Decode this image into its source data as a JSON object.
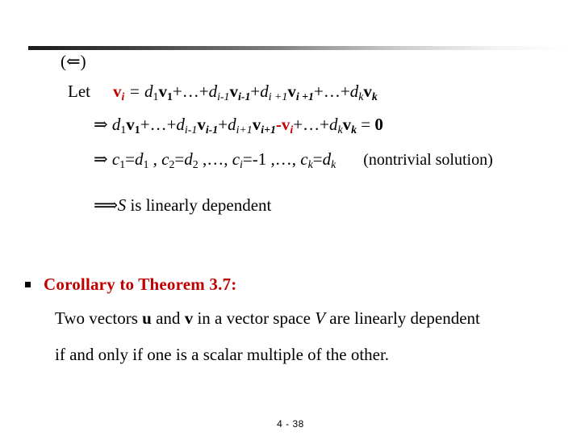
{
  "slide": {
    "direction_marker": "(⇐)",
    "let_label": "Let",
    "equation_1": {
      "lhs_vector": "v",
      "lhs_sub": "i",
      "equals": " = ",
      "terms": "d₁v₁+…+dᵢ₋₁vᵢ₋₁+dᵢ₊₁vᵢ₊₁+…+dₖvₖ",
      "plain": "v_i = d_1 v_1 + … + d_{i-1} v_{i-1} + d_{i+1} v_{i+1} + … + d_k v_k"
    },
    "equation_2": {
      "arrow": "⇒",
      "highlight": "-vᵢ",
      "plain": "⇒ d_1 v_1 + … + d_{i-1} v_{i-1} + d_{i+1} v_{i+1} - v_i + … + d_k v_k = 0",
      "rhs": "0"
    },
    "equation_3": {
      "arrow": "⇒",
      "plain": "⇒ c_1 = d_1 , c_2 = d_2 , …, c_i = -1 , …, c_k = d_k",
      "note": "(nontrivial solution)"
    },
    "equation_4": {
      "arrow": "⟹",
      "set_symbol": "S",
      "text": " is linearly dependent",
      "plain": "⟹ S is linearly dependent"
    },
    "corollary": {
      "bullet": "square-bullet",
      "title": "Corollary to Theorem 3.7:",
      "title_color": "#C00000",
      "statement_line_1_pre": "Two vectors ",
      "statement_u": "u",
      "statement_mid": " and ",
      "statement_v": "v",
      "statement_after": " in a vector space ",
      "statement_V": "V",
      "statement_end": " are linearly dependent",
      "statement_line_2": "if and only if one is a scalar multiple of the other.",
      "statement_plain_1": "Two vectors u and v in a vector space V are linearly dependent",
      "statement_plain_2": "if and only if one is a scalar multiple of the other."
    },
    "footer": "4 - 38",
    "accent_color": "#C00000",
    "divider": "gradient-rule"
  }
}
